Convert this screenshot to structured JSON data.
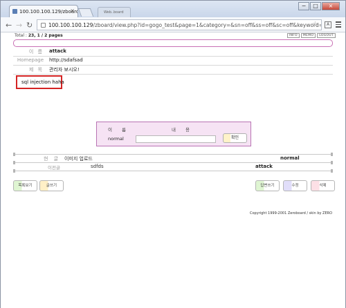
{
  "browser": {
    "tab_title": "100.100.100.129/zboard",
    "tab_close": "×",
    "inactive_tab": "Web..board",
    "url_host": "100.100.100.129",
    "url_path": "/zboard/view.php?id=gogo_test&page=1&category=&sn=off&ss=off&sc=off&keyword=&sc",
    "back_icon": "arrow-left",
    "forward_icon": "arrow-right",
    "reload_icon": "reload",
    "menu_icon": "hamburger"
  },
  "page": {
    "total_label": "Total : ",
    "total_value": "23, 1 / 2 pages",
    "toplinks": [
      "INFO",
      "MEMO",
      "LOGOUT"
    ],
    "post": {
      "name_label": "이 름",
      "name_value": "attack",
      "homepage_label": "Homepage",
      "homepage_value": "http://sdafsad",
      "subject_label": "제 목",
      "subject_value": "관리자 보시오!",
      "content": "sql injection haha"
    },
    "comment_form": {
      "name_header": "이 름",
      "content_header": "내 용",
      "name_value": "normal",
      "submit_label": "확인"
    },
    "list": [
      {
        "num": "현 글",
        "title": "이미지 업로드",
        "author": "normal"
      },
      {
        "num": "이전글",
        "title": "sdfds",
        "author": "attack"
      }
    ],
    "buttons": {
      "list": "목록보기",
      "write": "글쓰기",
      "reply": "답변쓰기",
      "modify": "수정",
      "delete": "삭제"
    },
    "copyright": "Copyright 1999-2001  Zeroboard / skin by ZERO"
  },
  "colors": {
    "highlight_box": "#d42323",
    "pink_border": "#c86fb4",
    "comment_bg": "#f6e3f4"
  }
}
